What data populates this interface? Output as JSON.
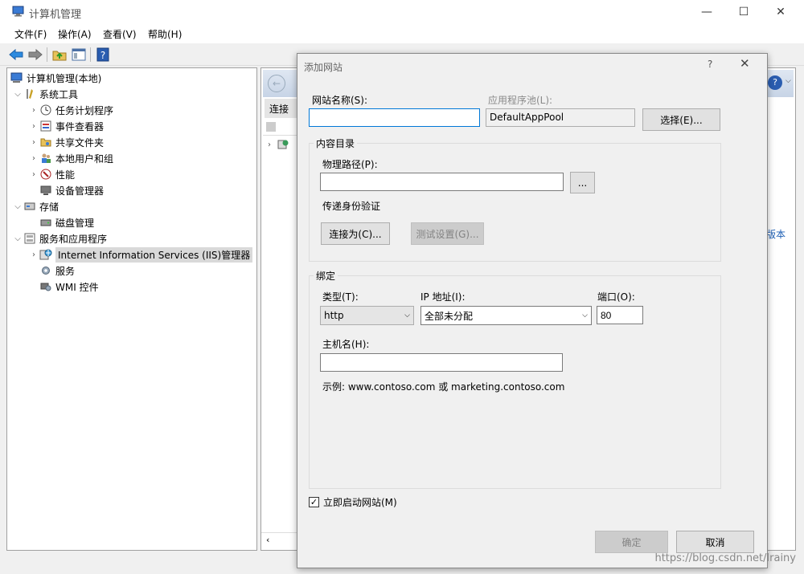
{
  "window": {
    "title": "计算机管理",
    "controls": {
      "minimize": "—",
      "maximize": "☐",
      "close": "✕"
    }
  },
  "menu": [
    "文件(F)",
    "操作(A)",
    "查看(V)",
    "帮助(H)"
  ],
  "tree": {
    "root": "计算机管理(本地)",
    "items": [
      {
        "label": "系统工具",
        "icon": "tools-icon"
      },
      {
        "label": "任务计划程序",
        "icon": "clock-icon"
      },
      {
        "label": "事件查看器",
        "icon": "event-viewer-icon"
      },
      {
        "label": "共享文件夹",
        "icon": "shared-folder-icon"
      },
      {
        "label": "本地用户和组",
        "icon": "users-icon"
      },
      {
        "label": "性能",
        "icon": "performance-icon"
      },
      {
        "label": "设备管理器",
        "icon": "device-manager-icon"
      },
      {
        "label": "存储",
        "icon": "storage-icon"
      },
      {
        "label": "磁盘管理",
        "icon": "disk-icon"
      },
      {
        "label": "服务和应用程序",
        "icon": "services-apps-icon"
      },
      {
        "label": "Internet Information Services (IIS)管理器",
        "icon": "iis-icon"
      },
      {
        "label": "服务",
        "icon": "gear-icon"
      },
      {
        "label": "WMI 控件",
        "icon": "wmi-icon"
      }
    ]
  },
  "right_panel": {
    "connections_header": "连接",
    "side_text": "版本"
  },
  "dialog": {
    "title": "添加网站",
    "help": "?",
    "close": "✕",
    "site_name_label": "网站名称(S):",
    "site_name_value": "",
    "app_pool_label": "应用程序池(L):",
    "app_pool_value": "DefaultAppPool",
    "select_button": "选择(E)...",
    "content_group": "内容目录",
    "physical_path_label": "物理路径(P):",
    "physical_path_value": "",
    "browse_button": "...",
    "passthrough_label": "传递身份验证",
    "connect_as_button": "连接为(C)...",
    "test_settings_button": "测试设置(G)...",
    "binding_group": "绑定",
    "type_label": "类型(T):",
    "type_value": "http",
    "ip_label": "IP 地址(I):",
    "ip_value": "全部未分配",
    "port_label": "端口(O):",
    "port_value": "80",
    "hostname_label": "主机名(H):",
    "hostname_value": "",
    "example_text": "示例: www.contoso.com 或 marketing.contoso.com",
    "start_checkbox_label": "立即启动网站(M)",
    "start_checked": true,
    "ok_button": "确定",
    "cancel_button": "取消"
  },
  "watermark": "https://blog.csdn.net/lrainy",
  "colors": {
    "focus_border": "#0078d7",
    "selection": "#d9d9d9",
    "accent_blue": "#1e5fb4"
  }
}
